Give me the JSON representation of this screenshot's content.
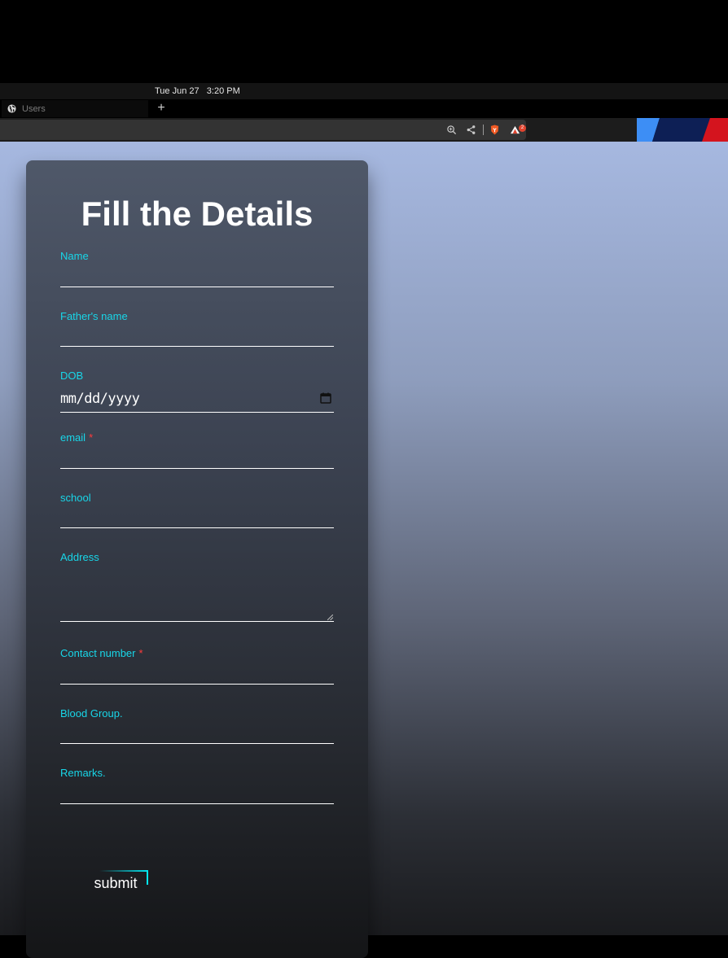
{
  "system_bar": {
    "clock": "Tue Jun 27   3:20 PM"
  },
  "browser": {
    "tab_title": "Users",
    "new_tab_label": "+",
    "toolbar_icons": [
      "zoom-icon",
      "share-icon",
      "brave-shield-icon",
      "brave-rewards-icon"
    ],
    "rewards_badge": "2"
  },
  "form": {
    "title": "Fill the Details",
    "fields": {
      "name": {
        "label": "Name",
        "value": ""
      },
      "father_name": {
        "label": "Father's name",
        "value": ""
      },
      "dob": {
        "label": "DOB",
        "placeholder": "mm/dd/yyyy"
      },
      "email": {
        "label": "email",
        "required_mark": "*",
        "value": ""
      },
      "school": {
        "label": "school",
        "value": ""
      },
      "address": {
        "label": "Address",
        "value": ""
      },
      "contact": {
        "label": "Contact number",
        "required_mark": "*",
        "value": ""
      },
      "blood_group": {
        "label": "Blood Group.",
        "value": ""
      },
      "remarks": {
        "label": "Remarks.",
        "value": ""
      }
    },
    "submit_label": "submit"
  },
  "colors": {
    "label": "#18d6e8",
    "required": "#ff3b3b",
    "accent": "#03e8f4"
  }
}
